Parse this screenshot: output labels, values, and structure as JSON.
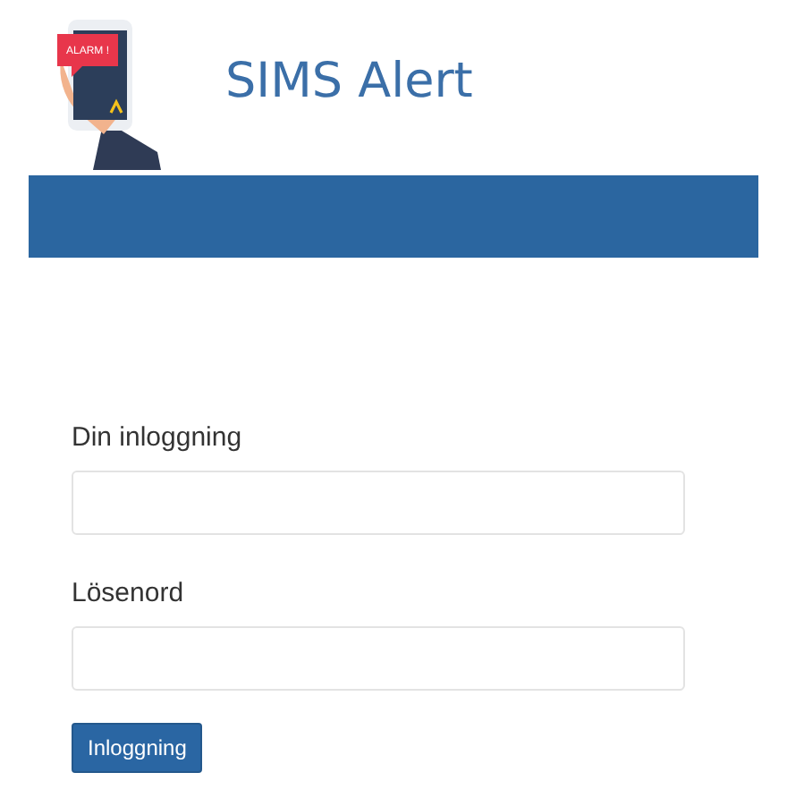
{
  "header": {
    "logo_badge": "ALARM !",
    "title": "SIMS Alert"
  },
  "form": {
    "fields": [
      {
        "label": "Din inloggning"
      },
      {
        "label": "Lösenord"
      }
    ],
    "submit": "Inloggning"
  }
}
